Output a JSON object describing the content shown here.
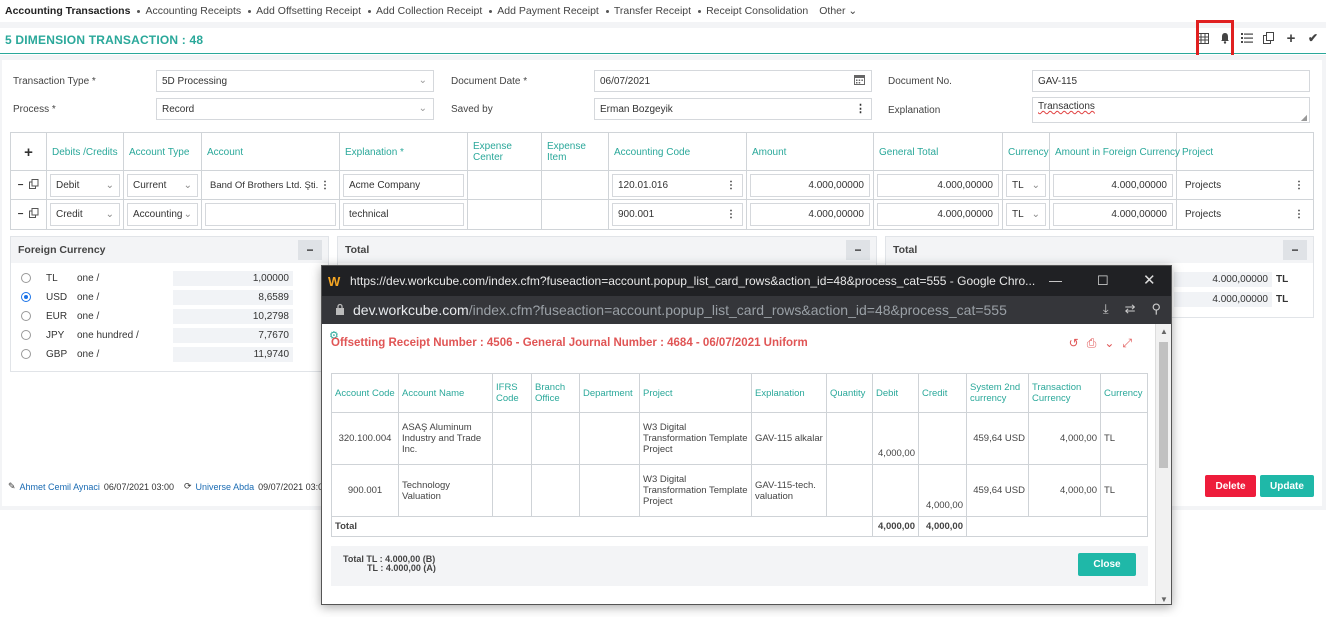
{
  "nav": {
    "items": [
      "Accounting Transactions",
      "Accounting Receipts",
      "Add Offsetting Receipt",
      "Add Collection Receipt",
      "Add Payment Receipt",
      "Transfer Receipt",
      "Receipt Consolidation"
    ],
    "other": "Other"
  },
  "title": "5 DIMENSION TRANSACTION : 48",
  "toolbar_icons": [
    "grid-icon",
    "bell-icon",
    "list-icon",
    "copy-icon",
    "plus-icon",
    "check-icon"
  ],
  "form": {
    "transaction_type_label": "Transaction Type *",
    "transaction_type_value": "5D Processing",
    "process_label": "Process *",
    "process_value": "Record",
    "document_date_label": "Document Date *",
    "document_date_value": "06/07/2021",
    "saved_by_label": "Saved by",
    "saved_by_value": "Erman Bozgeyik",
    "document_no_label": "Document No.",
    "document_no_value": "GAV-115",
    "explanation_label": "Explanation",
    "explanation_value": "Transactions"
  },
  "grid": {
    "headers": {
      "add": "+",
      "debits_credits": "Debits /Credits",
      "account_type": "Account Type",
      "account": "Account",
      "explanation": "Explanation *",
      "expense_center": "Expense Center",
      "expense_item": "Expense Item",
      "accounting_code": "Accounting Code",
      "amount": "Amount",
      "general_total": "General Total",
      "currency": "Currency",
      "amount_foreign": "Amount in Foreign Currency",
      "project": "Project"
    },
    "rows": [
      {
        "dc": "Debit",
        "account_type": "Current",
        "account": "Band Of Brothers Ltd. Şti.",
        "explanation": "Acme Company",
        "accounting_code": "120.01.016",
        "amount": "4.000,00000",
        "general_total": "4.000,00000",
        "currency": "TL",
        "amount_foreign": "4.000,00000",
        "project": "Projects"
      },
      {
        "dc": "Credit",
        "account_type": "Accounting",
        "account": "",
        "explanation": "technical",
        "accounting_code": "900.001",
        "amount": "4.000,00000",
        "general_total": "4.000,00000",
        "currency": "TL",
        "amount_foreign": "4.000,00000",
        "project": "Projects"
      }
    ]
  },
  "foreign_currency": {
    "title": "Foreign Currency",
    "rows": [
      {
        "code": "TL",
        "name": "one /",
        "rate": "1,00000",
        "selected": false
      },
      {
        "code": "USD",
        "name": "one /",
        "rate": "8,6589",
        "selected": true
      },
      {
        "code": "EUR",
        "name": "one /",
        "rate": "10,2798",
        "selected": false
      },
      {
        "code": "JPY",
        "name": "one hundred /",
        "rate": "7,7670",
        "selected": false
      },
      {
        "code": "GBP",
        "name": "one /",
        "rate": "11,9740",
        "selected": false
      }
    ]
  },
  "total_panel_1": {
    "title": "Total"
  },
  "total_panel_2": {
    "title": "Total",
    "values": [
      {
        "amount": "4.000,00000",
        "currency": "TL"
      },
      {
        "amount": "4.000,00000",
        "currency": "TL"
      }
    ]
  },
  "footer": {
    "creator": "Ahmet Cemil Aynaci",
    "created": "06/07/2021 03:00",
    "updater": "Universe Abda",
    "updated": "09/07/2021 03:00",
    "delete_label": "Delete",
    "update_label": "Update"
  },
  "popup": {
    "window_title": "https://dev.workcube.com/index.cfm?fuseaction=account.popup_list_card_rows&action_id=48&process_cat=555 - Google Chro...",
    "logo": "W",
    "url_domain": "dev.workcube.com",
    "url_path": "/index.cfm?fuseaction=account.popup_list_card_rows&action_id=48&process_cat=555",
    "heading": "Offsetting Receipt Number : 4506 - General Journal Number : 4684 - 06/07/2021 Uniform",
    "headers": [
      "Account Code",
      "Account Name",
      "IFRS Code",
      "Branch Office",
      "Department",
      "Project",
      "Explanation",
      "Quantity",
      "Debit",
      "Credit",
      "System 2nd currency",
      "Transaction Currency",
      "Currency"
    ],
    "rows": [
      {
        "account_code": "320.100.004",
        "account_name": "ASAŞ Aluminum Industry and Trade Inc.",
        "ifrs": "",
        "branch": "",
        "department": "",
        "project": "W3 Digital Transformation Template Project",
        "explanation": "GAV-115 alkalar",
        "quantity": "",
        "debit": "4,000,00",
        "credit": "",
        "system2": "459,64 USD",
        "transaction_currency": "4,000,00",
        "currency": "TL"
      },
      {
        "account_code": "900.001",
        "account_name": "Technology Valuation",
        "ifrs": "",
        "branch": "",
        "department": "",
        "project": "W3 Digital Transformation Template Project",
        "explanation": "GAV-115-tech. valuation",
        "quantity": "",
        "debit": "",
        "credit": "4,000,00",
        "system2": "459,64 USD",
        "transaction_currency": "4,000,00",
        "currency": "TL"
      }
    ],
    "total_label": "Total",
    "total_debit": "4,000,00",
    "total_credit": "4,000,00",
    "summary_line1": "Total TL : 4.000,00 (B)",
    "summary_line2": "TL : 4.000,00 (A)",
    "close_label": "Close"
  }
}
